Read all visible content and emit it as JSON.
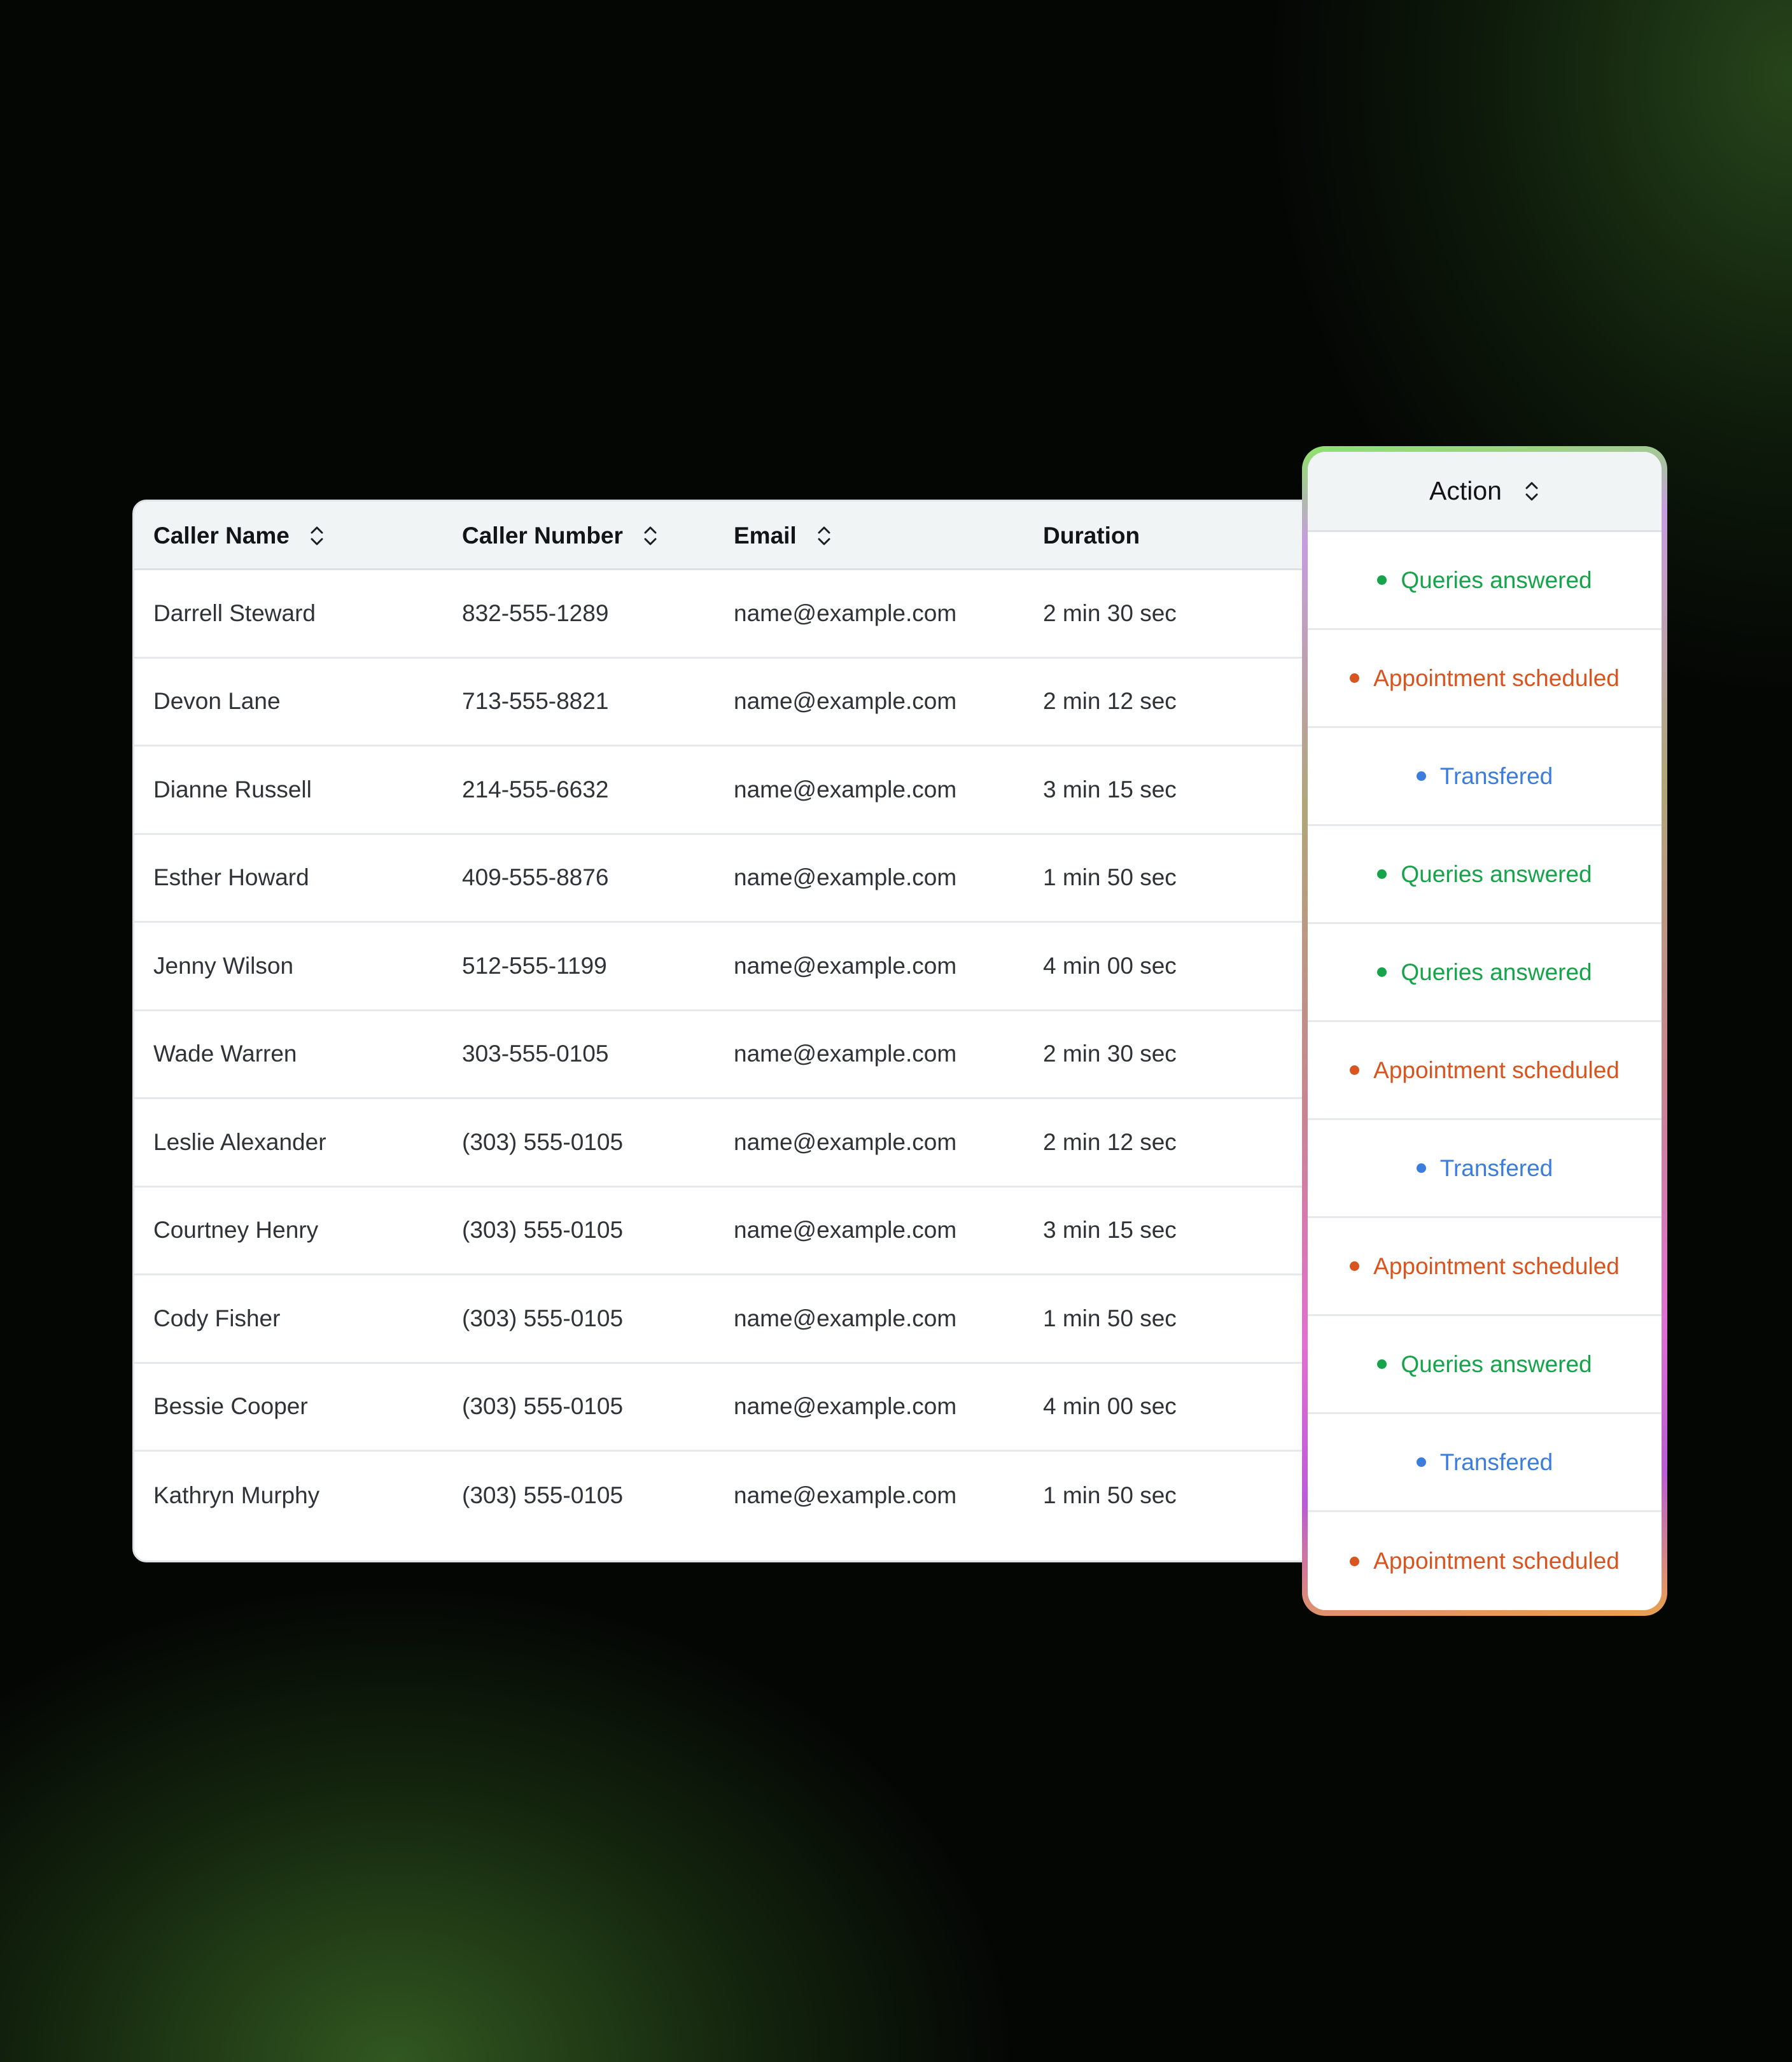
{
  "table": {
    "columns": {
      "caller_name": "Caller Name",
      "caller_number": "Caller Number",
      "email": "Email",
      "duration": "Duration",
      "action": "Action"
    },
    "rows": [
      {
        "name": "Darrell Steward",
        "number": "832-555-1289",
        "email": "name@example.com",
        "duration": "2 min 30 sec",
        "action": "Queries answered",
        "action_color": "#16a34a"
      },
      {
        "name": "Devon Lane",
        "number": "713-555-8821",
        "email": "name@example.com",
        "duration": "2 min 12 sec",
        "action": "Appointment scheduled",
        "action_color": "#d9541e"
      },
      {
        "name": "Dianne Russell",
        "number": "214-555-6632",
        "email": "name@example.com",
        "duration": "3 min 15 sec",
        "action": "Transfered",
        "action_color": "#3b7ddd"
      },
      {
        "name": "Esther Howard",
        "number": "409-555-8876",
        "email": "name@example.com",
        "duration": "1 min 50 sec",
        "action": "Queries answered",
        "action_color": "#16a34a"
      },
      {
        "name": "Jenny Wilson",
        "number": "512-555-1199",
        "email": "name@example.com",
        "duration": "4 min 00 sec",
        "action": "Queries answered",
        "action_color": "#16a34a"
      },
      {
        "name": "Wade Warren",
        "number": "303-555-0105",
        "email": "name@example.com",
        "duration": "2 min 30 sec",
        "action": "Appointment scheduled",
        "action_color": "#d9541e"
      },
      {
        "name": "Leslie Alexander",
        "number": "(303) 555-0105",
        "email": "name@example.com",
        "duration": "2 min 12 sec",
        "action": "Transfered",
        "action_color": "#3b7ddd"
      },
      {
        "name": "Courtney Henry",
        "number": "(303) 555-0105",
        "email": "name@example.com",
        "duration": "3 min 15 sec",
        "action": "Appointment scheduled",
        "action_color": "#d9541e"
      },
      {
        "name": "Cody Fisher",
        "number": "(303) 555-0105",
        "email": "name@example.com",
        "duration": "1 min 50 sec",
        "action": "Queries answered",
        "action_color": "#16a34a"
      },
      {
        "name": "Bessie Cooper",
        "number": "(303) 555-0105",
        "email": "name@example.com",
        "duration": "4 min 00 sec",
        "action": "Transfered",
        "action_color": "#3b7ddd"
      },
      {
        "name": "Kathryn Murphy",
        "number": "(303) 555-0105",
        "email": "name@example.com",
        "duration": "1 min 50 sec",
        "action": "Appointment scheduled",
        "action_color": "#d9541e"
      }
    ]
  },
  "icons": {
    "sort": "chevron-up-down-icon",
    "status": "status-dot-icon"
  },
  "colors": {
    "queries_answered": "#16a34a",
    "appointment_scheduled": "#d9541e",
    "transfered": "#3b7ddd",
    "header_bg": "#f1f4f5"
  }
}
